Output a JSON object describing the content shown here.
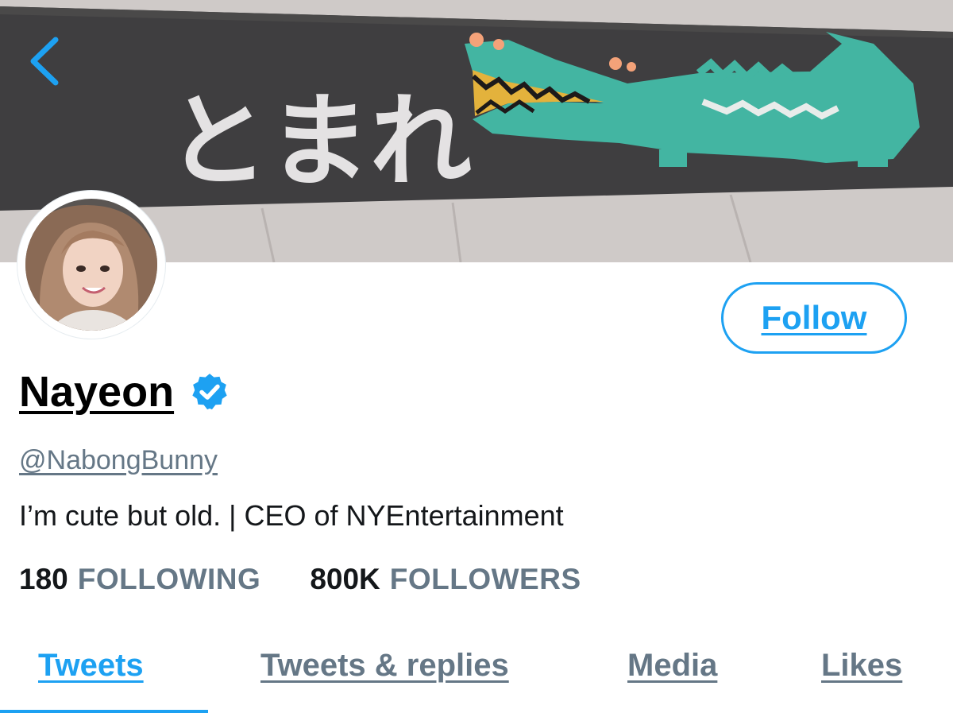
{
  "profile": {
    "display_name": "Nayeon",
    "handle": "@NabongBunny",
    "bio": "I’m cute but old. | CEO of NYEntertainment",
    "verified_icon": "verified-badge-icon",
    "following_count": "180",
    "following_label": "FOLLOWING",
    "followers_count": "800K",
    "followers_label": "FOLLOWERS"
  },
  "banner": {
    "painted_text": "とまれ",
    "icon": "crocodile-illustration"
  },
  "header": {
    "back_icon": "chevron-left-icon",
    "follow_label": "Follow"
  },
  "tabs": [
    {
      "label": "Tweets",
      "active": true
    },
    {
      "label": "Tweets & replies",
      "active": false
    },
    {
      "label": "Media",
      "active": false
    },
    {
      "label": "Likes",
      "active": false
    }
  ],
  "colors": {
    "accent": "#1da1f2",
    "secondary_text": "#657786",
    "primary_text": "#14171a"
  }
}
